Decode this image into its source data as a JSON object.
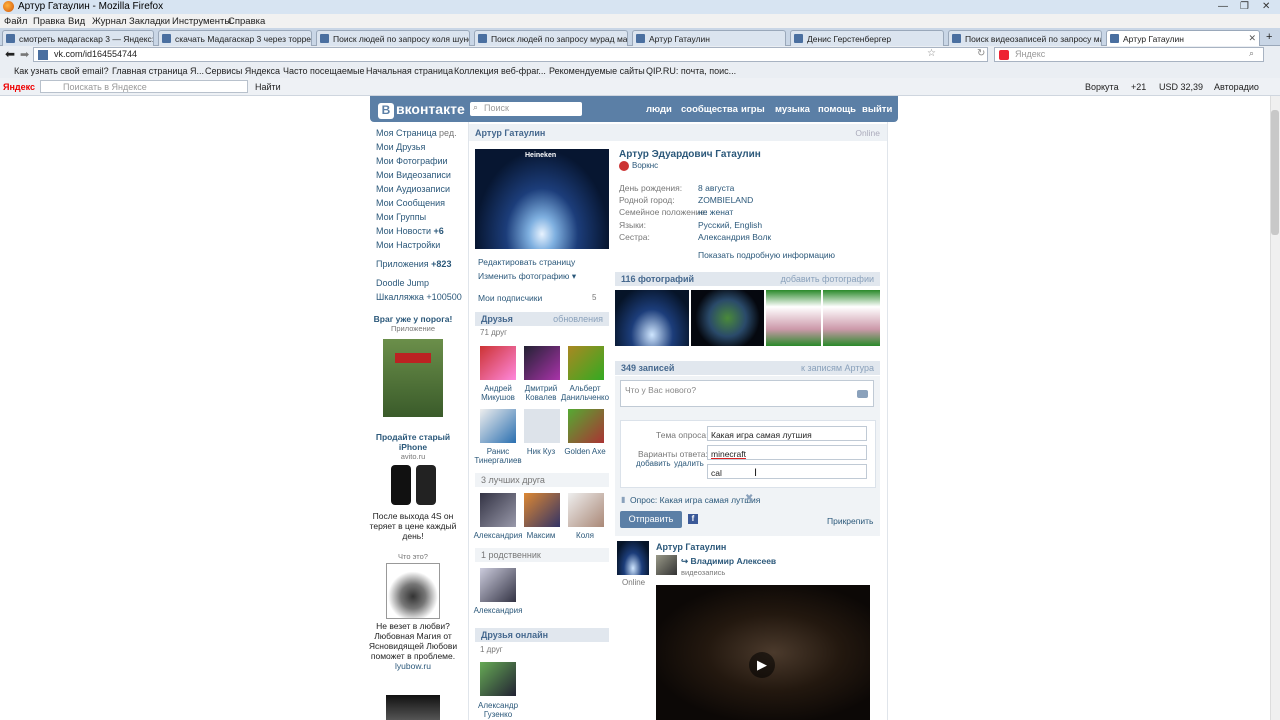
{
  "window": {
    "title": "Артур Гатаулин - Mozilla Firefox"
  },
  "menu": [
    "Файл",
    "Правка",
    "Вид",
    "Журнал",
    "Закладки",
    "Инструменты",
    "Справка"
  ],
  "tabs": [
    "смотреть мадагаскар 3 — Яндекс: ...",
    "скачать Мадагаскар 3 через торре...",
    "Поиск людей по запросу коля шунс...",
    "Поиск людей по запросу мурад мах...",
    "Артур Гатаулин",
    "Денис Герстенбергер",
    "Поиск видеозаписей по запросу мад...",
    "Артур Гатаулин"
  ],
  "url": "vk.com/id164554744",
  "browser_search_placeholder": "Яндекс",
  "bookmarks": [
    "Как узнать свой email?",
    "Главная страница Я...",
    "Сервисы Яндекса",
    "Часто посещаемые",
    "Начальная страница",
    "Коллекция веб-фраг...",
    "Рекомендуемые сайты",
    "QIP.RU: почта, поис..."
  ],
  "yandex_bar": {
    "brand": "Яндекс",
    "search_placeholder": "Поискать в Яндексе",
    "go": "Найти",
    "vorkuta": "Воркута",
    "temp": "+21",
    "usd": "USD 32,39",
    "autoradio": "Авторадио"
  },
  "vk": {
    "logo": "вконтакте",
    "search_placeholder": "Поиск",
    "nav": [
      "люди",
      "сообщества",
      "игры",
      "музыка",
      "помощь",
      "выйти"
    ],
    "left_menu": [
      "Моя Страница",
      "Мои Друзья",
      "Мои Фотографии",
      "Мои Видеозаписи",
      "Мои Аудиозаписи",
      "Мои Сообщения",
      "Мои Группы",
      "Мои Новости",
      "Мои Настройки"
    ],
    "edit": "ред.",
    "news_count": "+6",
    "apps": "Приложения",
    "apps_count": "+823",
    "doodle": "Doodle Jump",
    "shkalyazhka": "Шкалляжка +100500",
    "ad1_title": "Враг уже у порога!",
    "ad1_sub": "Приложение",
    "ad2_title": "Продайте старый iPhone",
    "ad2_site": "avito.ru",
    "ad2_text": "После выхода 4S он теряет в цене каждый день!",
    "ad3_q": "Что это?",
    "ad3_text": "Не везет в любви? Любовная Магия от Ясновидящей Любови поможет в проблеме.",
    "ad3_site": "lyubow.ru",
    "profile_name_short": "Артур Гатаулин",
    "online": "Online",
    "full_name": "Артур Эдуардович Гатаулин",
    "city_badge": "Воркнс",
    "avatar_brand": "Heineken",
    "info_labels": [
      "День рождения:",
      "Родной город:",
      "Семейное положение:",
      "Языки:",
      "Сестра:"
    ],
    "info_values": [
      "8 августа",
      "ZOMBIELAND",
      "не женат",
      "Русский, English",
      "Александрия Волк"
    ],
    "more_info": "Показать подробную информацию",
    "edit_page": "Редактировать страницу",
    "change_photo": "Изменить фотографию",
    "subscriptions": "Мои подписчики",
    "subs_count": "5",
    "friends_head": "Друзья",
    "friends_updates": "обновления",
    "friends_count": "71 друг",
    "friends": [
      "Андрей Микушов",
      "Дмитрий Ковалев",
      "Альберт Данильченко",
      "Ранис Тинергалиев",
      "Ник Куз",
      "Golden Axe"
    ],
    "best_head": "3 лучших друга",
    "best": [
      "Александрия",
      "Максим",
      "Коля"
    ],
    "relatives_head": "1 родственник",
    "relatives": [
      "Александрия"
    ],
    "online_head": "Друзья онлайн",
    "online_count": "1 друг",
    "online_friends": [
      "Александр Гузенко"
    ],
    "photos_head": "116 фотографий",
    "add_photos": "добавить фотографии",
    "posts_head": "349 записей",
    "posts_to": "к записям Артура",
    "post_placeholder": "Что у Вас нового?",
    "poll_topic_label": "Тема опроса:",
    "poll_topic": "Какая игра самая лутшия",
    "poll_options_label": "Варианты ответа:",
    "poll_add": "добавить",
    "poll_delete": "удалить",
    "poll_opt1": "minecraft",
    "poll_opt2": "cal",
    "poll_tag": "Опрос: Какая игра самая лутшия",
    "send": "Отправить",
    "attach": "Прикрепить",
    "post_author": "Артур Гатаулин",
    "post_online": "Online",
    "repost_author": "Владимир Алексеев",
    "repost_type": "видеозапись"
  }
}
